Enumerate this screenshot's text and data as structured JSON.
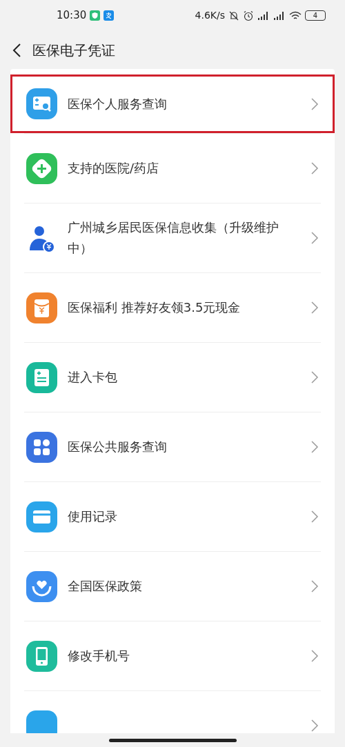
{
  "status_bar": {
    "time": "10:30",
    "speed": "4.6K/s",
    "battery": "4"
  },
  "header": {
    "title": "医保电子凭证"
  },
  "items": [
    {
      "kind": "query",
      "label": "医保个人服务查询",
      "highlighted": true
    },
    {
      "kind": "hospital",
      "label": "支持的医院/药店",
      "highlighted": false
    },
    {
      "kind": "person",
      "label": "广州城乡居民医保信息收集（升级维护中）",
      "highlighted": false
    },
    {
      "kind": "gift",
      "label": "医保福利 推荐好友领3.5元现金",
      "highlighted": false
    },
    {
      "kind": "cardplus",
      "label": "进入卡包",
      "highlighted": false
    },
    {
      "kind": "apps",
      "label": "医保公共服务查询",
      "highlighted": false
    },
    {
      "kind": "card",
      "label": "使用记录",
      "highlighted": false
    },
    {
      "kind": "heart",
      "label": "全国医保政策",
      "highlighted": false
    },
    {
      "kind": "phone",
      "label": "修改手机号",
      "highlighted": false
    },
    {
      "kind": "partial",
      "highlighted": false
    }
  ]
}
